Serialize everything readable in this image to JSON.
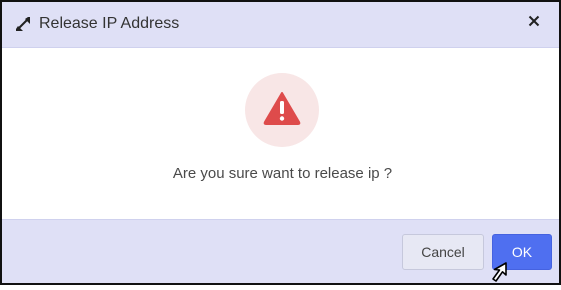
{
  "dialog": {
    "title": "Release IP Address",
    "title_icon": "expand-arrows-icon",
    "close_icon": "close-icon",
    "close_label": "×"
  },
  "body": {
    "warning_icon": "warning-triangle-icon",
    "message": "Are you sure want to release ip ?"
  },
  "footer": {
    "cancel_label": "Cancel",
    "ok_label": "OK"
  },
  "colors": {
    "header_bg": "#dfe0f6",
    "ok_button": "#4f6ff0",
    "warning_red": "#de4b4b",
    "warning_circle": "#f8e6e6"
  }
}
